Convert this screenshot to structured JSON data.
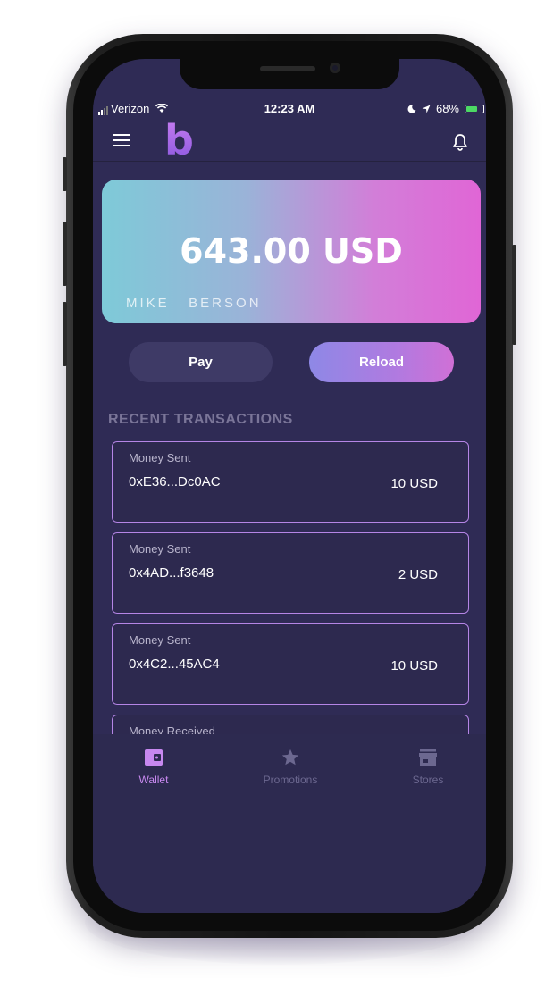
{
  "status_bar": {
    "carrier": "Verizon",
    "time": "12:23 AM",
    "battery": "68%"
  },
  "header": {
    "logo": "b",
    "menu_icon": "hamburger-menu-icon",
    "notifications_icon": "bell-icon"
  },
  "card": {
    "balance": "643.00 USD",
    "holder": "MIKE   BERSON"
  },
  "actions": {
    "pay_label": "Pay",
    "reload_label": "Reload"
  },
  "transactions": {
    "title": "RECENT TRANSACTIONS",
    "items": [
      {
        "type": "Money Sent",
        "address": "0xE36...Dc0AC",
        "amount": "10 USD"
      },
      {
        "type": "Money Sent",
        "address": "0x4AD...f3648",
        "amount": "2 USD"
      },
      {
        "type": "Money Sent",
        "address": "0x4C2...45AC4",
        "amount": "10 USD"
      },
      {
        "type": "Money Received",
        "address": "",
        "amount": ""
      }
    ]
  },
  "tabs": [
    {
      "label": "Wallet",
      "icon": "wallet-icon",
      "active": true
    },
    {
      "label": "Promotions",
      "icon": "star-icon",
      "active": false
    },
    {
      "label": "Stores",
      "icon": "store-icon",
      "active": false
    }
  ],
  "colors": {
    "background": "#2f2b55",
    "accent": "#c788ef",
    "card_gradient_start": "#7ecad8",
    "card_gradient_end": "#e066d6"
  }
}
